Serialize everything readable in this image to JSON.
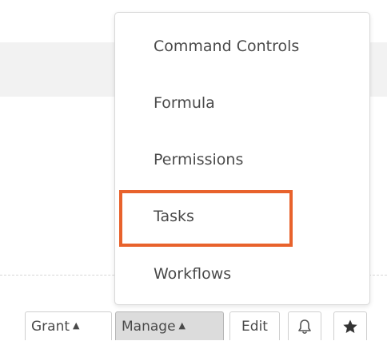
{
  "menu": {
    "items": [
      {
        "label": "Command Controls"
      },
      {
        "label": "Formula"
      },
      {
        "label": "Permissions"
      },
      {
        "label": "Tasks",
        "highlighted": true
      },
      {
        "label": "Workflows"
      }
    ]
  },
  "toolbar": {
    "grant_label": "Grant",
    "manage_label": "Manage",
    "edit_label": "Edit",
    "notifications_icon": "bell-icon",
    "favorite_icon": "star-icon"
  },
  "colors": {
    "highlight": "#e8622c",
    "active_button_bg": "#dcdcdc",
    "text": "#4a4a4a"
  }
}
